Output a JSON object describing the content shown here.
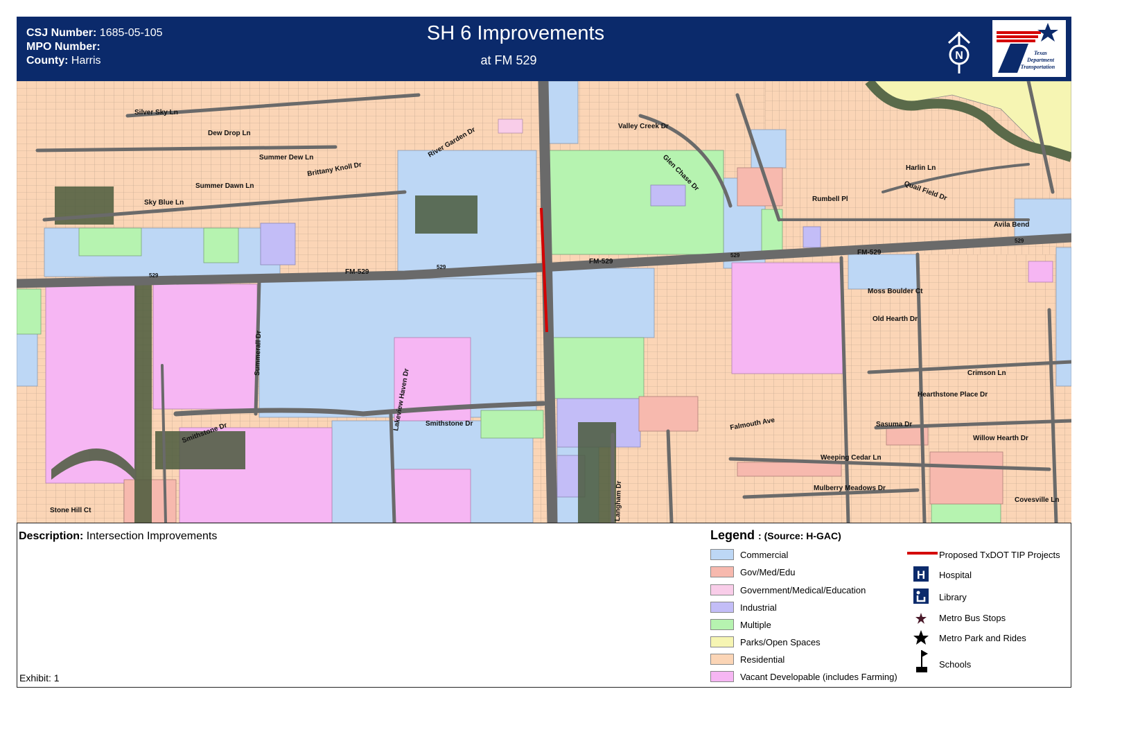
{
  "header": {
    "csj_label": "CSJ Number:",
    "csj_value": "1685-05-105",
    "mpo_label": "MPO Number:",
    "mpo_value": "",
    "county_label": "County:",
    "county_value": "Harris",
    "title": "SH 6 Improvements",
    "subtitle": "at FM 529",
    "north_icon": "north-arrow-icon",
    "logo_text": [
      "Texas",
      "Department",
      "of Transportation"
    ]
  },
  "map": {
    "road_labels": [
      "FM-529",
      "FM-529",
      "FM-529",
      "529",
      "529",
      "529",
      "529",
      "Smithstone Dr",
      "Lakeview Haven Dr",
      "Hearthstone Place Dr",
      "Willow Hearth Dr",
      "Moss Boulder Ct",
      "Old Hearth Dr",
      "Rumbell Pl",
      "Avila Bend",
      "Valley Creek Dr",
      "Glen Chase Dr",
      "Summer Dew Ln",
      "Summer Dawn Ln",
      "Sky Blue Ln",
      "Silver Sky Ln",
      "Dew Drop Ln",
      "River Garden Dr",
      "Brittany Knoll Dr",
      "Summerall Dr",
      "Langham Dr",
      "Falmouth Ave",
      "Weeping Cedar Ln",
      "Mulberry Meadows Dr",
      "Sasuma Dr",
      "Crimson Ln",
      "Covesville Ln",
      "Smithstone Dr",
      "Stone Hill Ct",
      "Quail Field Dr",
      "Harlin Ln"
    ],
    "project_color": "#d40000"
  },
  "description": {
    "label": "Description:",
    "value": "Intersection Improvements"
  },
  "exhibit": "Exhibit: 1",
  "legend": {
    "title": "Legend",
    "source": ": (Source: H-GAC)",
    "land_use": [
      {
        "label": "Commercial",
        "color": "#bdd7f5"
      },
      {
        "label": "Gov/Med/Edu",
        "color": "#f7b9ae"
      },
      {
        "label": "Government/Medical/Education",
        "color": "#f9cde9"
      },
      {
        "label": "Industrial",
        "color": "#c3bdf7"
      },
      {
        "label": "Multiple",
        "color": "#b6f3b0"
      },
      {
        "label": "Parks/Open Spaces",
        "color": "#f6f5b3"
      },
      {
        "label": "Residential",
        "color": "#fbd5b6"
      },
      {
        "label": "Vacant Developable (includes Farming)",
        "color": "#f6b6f3"
      }
    ],
    "symbols": [
      {
        "label": "Proposed TxDOT TIP Projects",
        "icon": "red-line-icon"
      },
      {
        "label": "Hospital",
        "icon": "hospital-icon"
      },
      {
        "label": "Library",
        "icon": "library-icon"
      },
      {
        "label": "Metro Bus Stops",
        "icon": "bus-stop-star-icon"
      },
      {
        "label": "Metro Park and Rides",
        "icon": "park-ride-star-icon"
      },
      {
        "label": "Schools",
        "icon": "school-flag-icon"
      }
    ]
  }
}
